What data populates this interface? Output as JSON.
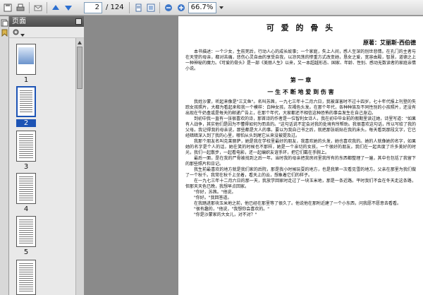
{
  "toolbar": {
    "page_current": "2",
    "page_total": "/ 124",
    "zoom_value": "66.7%"
  },
  "panel": {
    "title": "页面",
    "thumbnails": [
      "1",
      "2",
      "3",
      "4",
      "5"
    ],
    "selected_index": 1
  },
  "document": {
    "title": "可 爱 的 骨 头",
    "author": "原著：艾丽斯·西伯德",
    "intro": [
      "本书描述：一个少女，生前死后，行动人心的成长故事；一个家庭，失上人间，感人至深的别世悲情。在孔门的主者与在天堂的母亲，都对苦痛，悲伤心灵自由的享受自我，以凉风荡的惨重方式改变她，恳女之爱，宽容由殿，智慧，道德之上一种神秘的魔力。《可爱的骨头》是一部《美丽人生》以来，又一本超越形态、国家、年龄、性别、感动无数读者的家庭亲情小说。"
    ],
    "chapter": "第 一 章",
    "subtitle": "一 生 不 断 地 爱 到 伤 害",
    "body": [
      "我姓沙蒙，听起来像是\"三文鱼\"。名叫苏茜，一九七三年十二月六日，我被谋害时不过十四岁。七十年代报上刊登的失踪女孩照片，大都为看起来和我一个模样：白种女孩，灰褐色头发。在那个年代，各种种族及不同性别的小孩照片，还没有出现在牛奶盒或是每天的邮递广告上，在那个年代，大家都还不相信这种恐怖的事会发生在自己身边。",
      "到初中我一直有一张很喜欢的诗，那首诗的作者是一位智利女诗人，我在初中毕业前的假期里读过她，诗里写道：\"如果有人战争，其实他们是因为不懂得如何为而去的。\"这句话说不定会对我的处境有所帮助。我很喜欢这句话，所以写给了我的父母。我记得我的母亲说，那些都是大人的事。要以为我自己书之后，就把那张纸贴在我的床头。每天看到那段文字，它已经暗暗深入到了我的心里，哪怕从头到尾它从来没被提及过。",
      "我那个朋友名叫克莱丽萨，她是我在学校里最好的朋友，我喜欢她的头发，她也喜欢我的。她的人就像她的名字，如果她的名字是个人的话，她在笑的时候也不那样，她是一个亲切的女孩，一个很好的朋友。我们在一起共度了许多美好的时光，我们一起散步，一起看电影，还一起编织友谊手环，把它们戴在手腕上。",
      "最后一面，是在我的尸骨被找到之后一年。当时我的母亲把我房间里我所有的东西都整理了一遍，其中也包括了我留下的那些照片和日记。",
      "我生前最喜欢的地方就是我们家的后院，那是我小时候玩耍的地方，也是我第一次看见雪的地方。父亲在那里为我们做了一个秋千。我常在秋千上坐着，看天上的云，想象着它们的样子。",
      "在一九七三年十二月六日的那一天，我放学回家时走过了一块玉米地，那是一条近路。平时我们不会在冬天走这条路，但那天天色已晚，我想早点回家。",
      "\"你好，苏茜。\"他说。",
      "\"你好。\"我回答道。",
      "在我踏进那块玉米地之前，他已经在那里等了很久了。他说他在那附近建了一个小东西，问我愿不愿意去看看。",
      "\"很有趣的，\"他说，\"我想你会喜欢的。\"",
      "\"你是沙蒙家的大女儿，对不对？\""
    ]
  }
}
